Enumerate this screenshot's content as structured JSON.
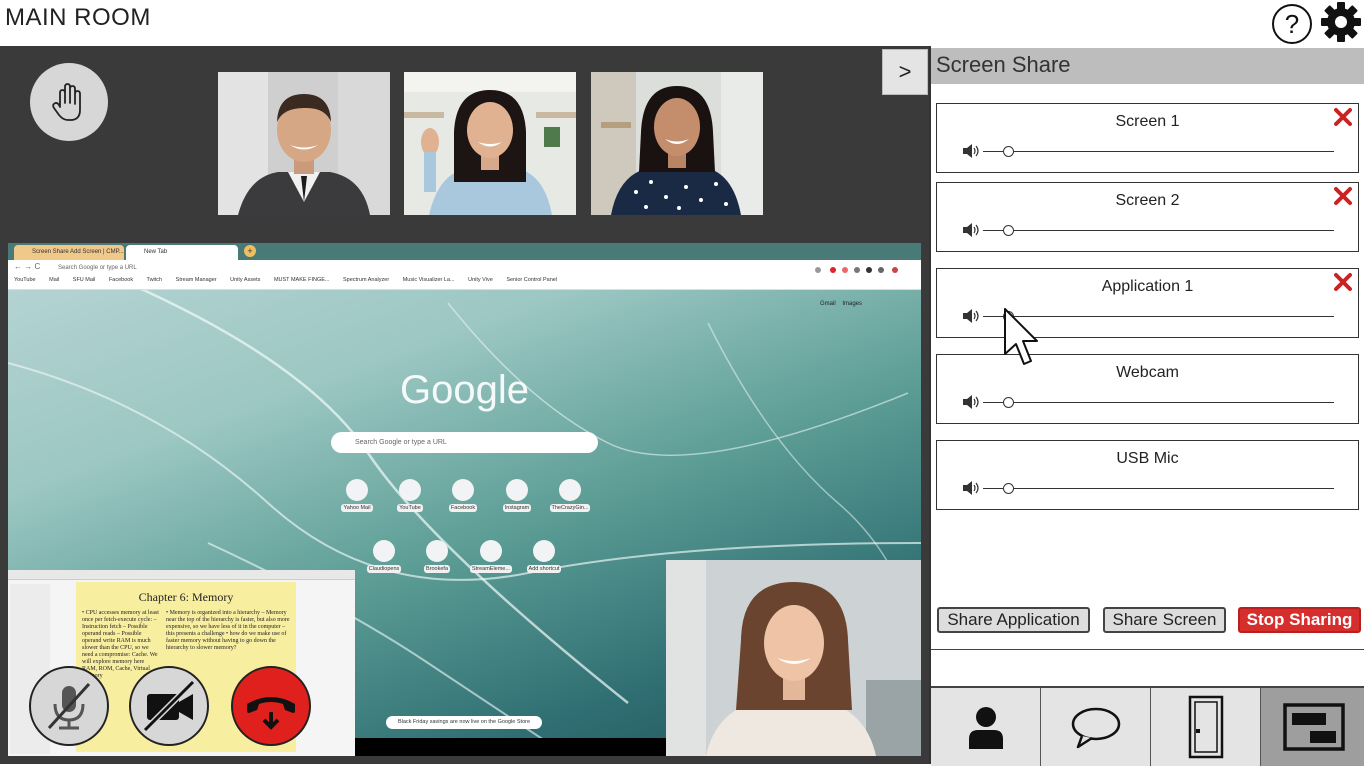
{
  "app": {
    "room_title": "MAIN ROOM"
  },
  "header": {
    "help_label": "?"
  },
  "stage": {
    "collapse_label": ">",
    "participants": [
      "participant-1",
      "participant-2",
      "participant-3"
    ]
  },
  "browser": {
    "tabs": [
      "Screen Share Add Screen | CMP...",
      "New Tab"
    ],
    "address": "Search Google or type a URL",
    "bookmarks": [
      "YouTube",
      "Mail",
      "SFU Mail",
      "Facebook",
      "Twitch",
      "Stream Manager",
      "Unity Assets",
      "MUST MAKE FINGE...",
      "Spectrum Analyzer",
      "Music Visualizer La...",
      "Unity Vive",
      "Senior Control Panel"
    ],
    "gmail": "Gmail",
    "images": "Images",
    "logo": "Google",
    "search_placeholder": "Search Google or type a URL",
    "shortcuts_row1": [
      "Yahoo Mail",
      "YouTube",
      "Facebook",
      "Instagram",
      "TheCrazyGin..."
    ],
    "shortcuts_row2": [
      "Claudiopens",
      "Brookefa",
      "StreamEleme...",
      "Add shortcut"
    ],
    "promo": "Black Friday savings are now live on the Google Store"
  },
  "slide": {
    "title": "Chapter 6:  Memory",
    "left_text": "• CPU accesses memory at least once per fetch-execute cycle: – Instruction fetch – Possible operand reads – Possible operand write RAM is much slower than the CPU, so we need a compromise: Cache. We will explore memory here RAM, ROM, Cache, Virtual Memory",
    "right_text": "• Memory is organized into a hierarchy – Memory near the top of the hierarchy is faster, but also more expensive, so we have less of it in the computer – this presents a challenge • how do we make use of faster memory without having to go down the hierarchy to slower memory?"
  },
  "panel": {
    "title": "Screen Share",
    "sources": [
      {
        "name": "Screen 1",
        "volume": 0.07,
        "removable": true
      },
      {
        "name": "Screen 2",
        "volume": 0.07,
        "removable": true
      },
      {
        "name": "Application 1",
        "volume": 0.07,
        "removable": true
      },
      {
        "name": "Webcam",
        "volume": 0.07,
        "removable": false
      },
      {
        "name": "USB Mic",
        "volume": 0.07,
        "removable": false
      }
    ],
    "share_application": "Share Application",
    "share_screen": "Share Screen",
    "stop_sharing": "Stop Sharing"
  },
  "nav": [
    "participants",
    "chat",
    "leave-room",
    "screen-share"
  ],
  "colors": {
    "stop": "#d62d2d",
    "remove": "#cc2222",
    "hangup": "#e0201c",
    "stage_bg": "#3a3a3a"
  }
}
